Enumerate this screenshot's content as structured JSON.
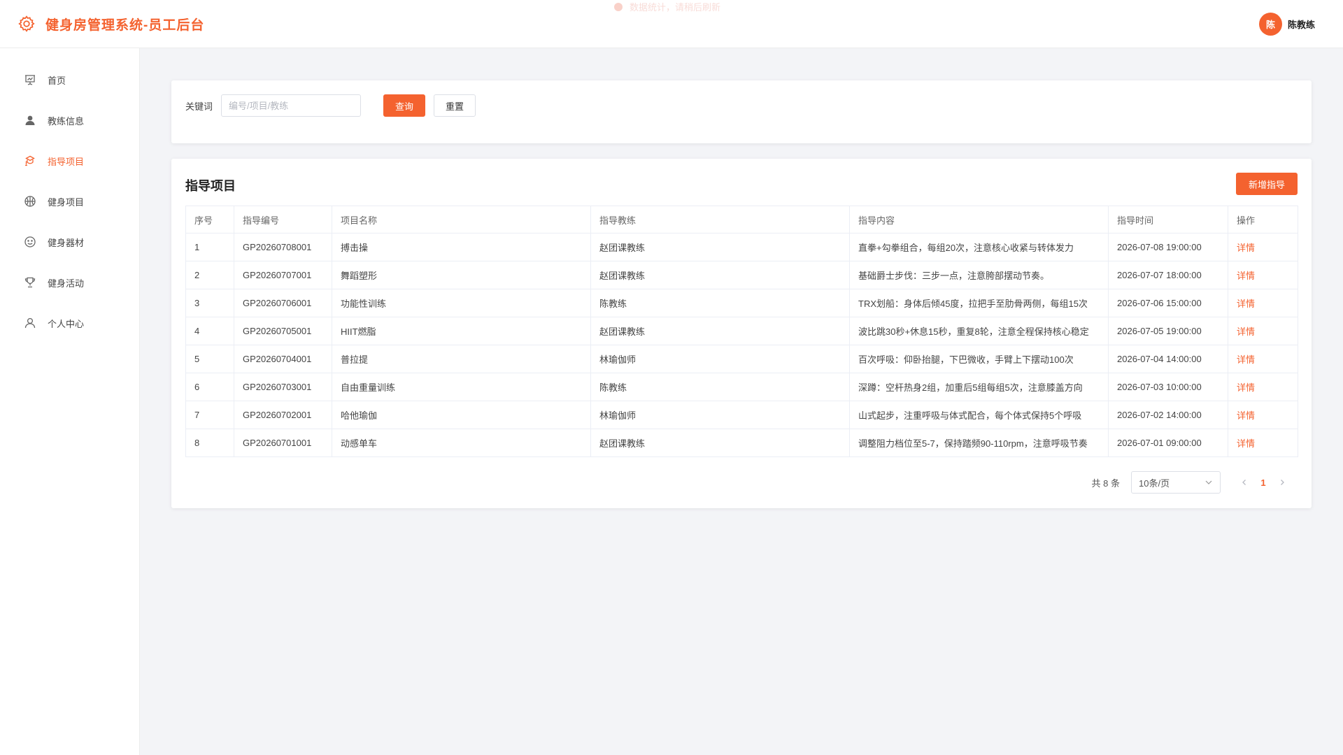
{
  "header": {
    "title": "健身房管理系统-员工后台",
    "logo_icon": "gear-icon",
    "toast_text": "数据统计，请稍后刷新",
    "user": {
      "avatar_text": "陈",
      "name": "陈教练"
    }
  },
  "sidebar": {
    "items": [
      {
        "label": "首页",
        "icon": "presentation-icon"
      },
      {
        "label": "教练信息",
        "icon": "user-solid-icon"
      },
      {
        "label": "指导项目",
        "icon": "guide-icon",
        "active": true
      },
      {
        "label": "健身项目",
        "icon": "basketball-icon"
      },
      {
        "label": "健身器材",
        "icon": "smile-icon"
      },
      {
        "label": "健身活动",
        "icon": "trophy-icon"
      },
      {
        "label": "个人中心",
        "icon": "user-outline-icon"
      }
    ]
  },
  "search": {
    "label": "关键词",
    "placeholder": "编号/项目/教练",
    "query_label": "查询",
    "reset_label": "重置"
  },
  "list": {
    "title": "指导项目",
    "add_label": "新增指导",
    "columns": [
      "序号",
      "指导编号",
      "项目名称",
      "指导教练",
      "指导内容",
      "指导时间",
      "操作"
    ],
    "rows": [
      {
        "idx": "1",
        "code": "GP20260708001",
        "name": "搏击操",
        "coach": "赵团课教练",
        "content": "直拳+勾拳组合，每组20次，注意核心收紧与转体发力",
        "time": "2026-07-08 19:00:00",
        "op": "详情"
      },
      {
        "idx": "2",
        "code": "GP20260707001",
        "name": "舞蹈塑形",
        "coach": "赵团课教练",
        "content": "基础爵士步伐：三步一点，注意胯部摆动节奏。",
        "time": "2026-07-07 18:00:00",
        "op": "详情"
      },
      {
        "idx": "3",
        "code": "GP20260706001",
        "name": "功能性训练",
        "coach": "陈教练",
        "content": "TRX划船：身体后倾45度，拉把手至肋骨两侧，每组15次",
        "time": "2026-07-06 15:00:00",
        "op": "详情"
      },
      {
        "idx": "4",
        "code": "GP20260705001",
        "name": "HIIT燃脂",
        "coach": "赵团课教练",
        "content": "波比跳30秒+休息15秒，重复8轮，注意全程保持核心稳定",
        "time": "2026-07-05 19:00:00",
        "op": "详情"
      },
      {
        "idx": "5",
        "code": "GP20260704001",
        "name": "普拉提",
        "coach": "林瑜伽师",
        "content": "百次呼吸：仰卧抬腿，下巴微收，手臂上下摆动100次",
        "time": "2026-07-04 14:00:00",
        "op": "详情"
      },
      {
        "idx": "6",
        "code": "GP20260703001",
        "name": "自由重量训练",
        "coach": "陈教练",
        "content": "深蹲：空杆热身2组，加重后5组每组5次，注意膝盖方向",
        "time": "2026-07-03 10:00:00",
        "op": "详情"
      },
      {
        "idx": "7",
        "code": "GP20260702001",
        "name": "哈他瑜伽",
        "coach": "林瑜伽师",
        "content": "山式起步，注重呼吸与体式配合，每个体式保持5个呼吸",
        "time": "2026-07-02 14:00:00",
        "op": "详情"
      },
      {
        "idx": "8",
        "code": "GP20260701001",
        "name": "动感单车",
        "coach": "赵团课教练",
        "content": "调整阻力档位至5-7，保持踏频90-110rpm，注意呼吸节奏",
        "time": "2026-07-01 09:00:00",
        "op": "详情"
      }
    ]
  },
  "pagination": {
    "total_text": "共 8 条",
    "page_size": "10条/页",
    "current_page": "1"
  },
  "colors": {
    "accent": "#f4622f"
  }
}
